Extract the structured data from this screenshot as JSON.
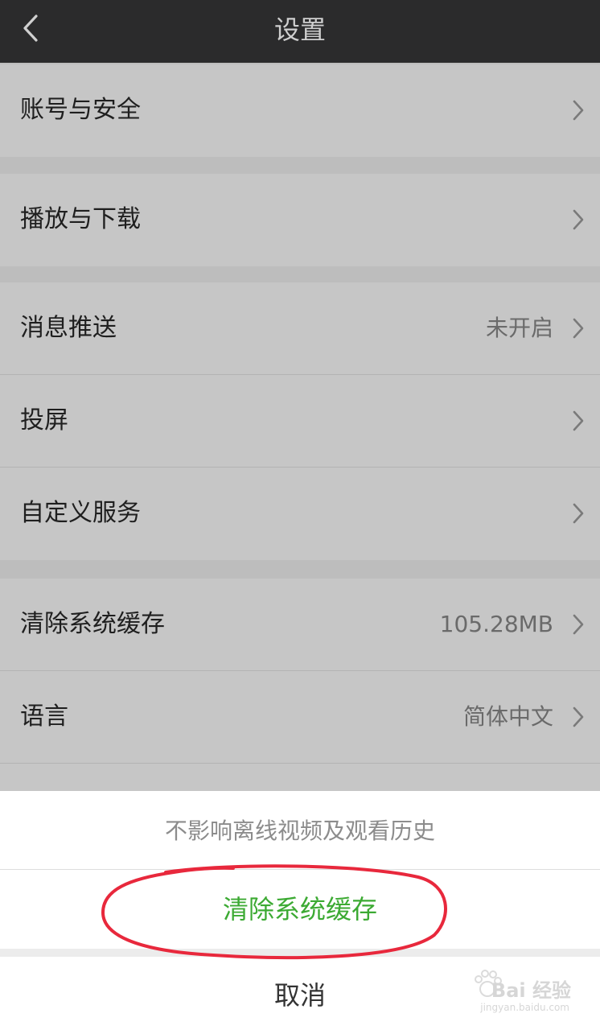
{
  "header": {
    "title": "设置",
    "back_icon": "chevron-left-icon"
  },
  "settings": {
    "account_security": {
      "label": "账号与安全"
    },
    "play_download": {
      "label": "播放与下载"
    },
    "message_push": {
      "label": "消息推送",
      "value": "未开启"
    },
    "cast_screen": {
      "label": "投屏"
    },
    "custom_services": {
      "label": "自定义服务"
    },
    "clear_cache": {
      "label": "清除系统缓存",
      "value": "105.28MB"
    },
    "language": {
      "label": "语言",
      "value": "简体中文"
    }
  },
  "action_sheet": {
    "hint": "不影响离线视频及观看历史",
    "confirm_label": "清除系统缓存",
    "cancel_label": "取消"
  },
  "watermark": {
    "brand": "Bai 经验",
    "url": "jingyan.baidu.com"
  },
  "colors": {
    "navbar": "#2b2b2c",
    "confirm_green": "#3caa33",
    "annotation_red": "#e8283c"
  }
}
